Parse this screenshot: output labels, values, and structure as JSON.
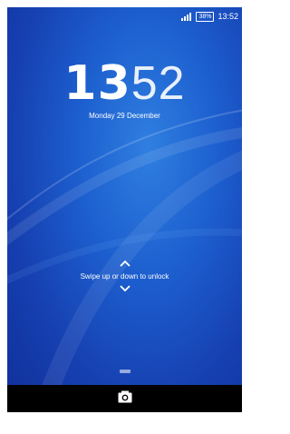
{
  "status_bar": {
    "signal_icon": "signal-icon",
    "battery_text": "38%",
    "time": "13:52"
  },
  "lock_screen": {
    "clock_hours": "13",
    "clock_minutes": "52",
    "date": "Monday 29 December",
    "unlock_hint": "Swipe up or down to unlock"
  },
  "icons": {
    "chevron_up": "chevron-up-icon",
    "chevron_down": "chevron-down-icon",
    "camera": "camera-icon"
  },
  "colors": {
    "wallpaper_primary": "#1d5fcf",
    "wallpaper_dark": "#10309a",
    "text": "#ffffff",
    "nav_bar": "#000000"
  }
}
